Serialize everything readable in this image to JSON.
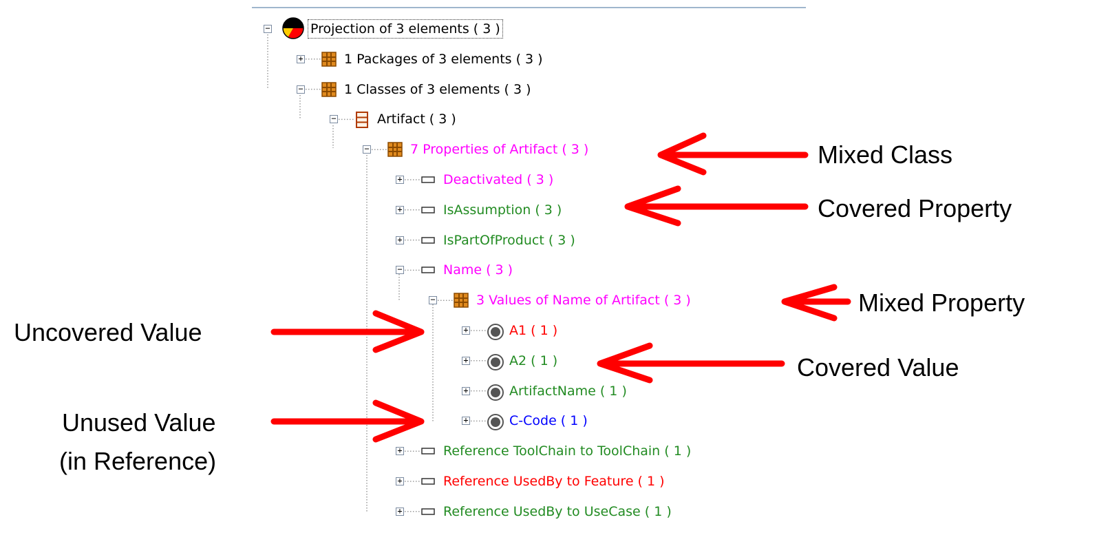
{
  "tree": {
    "rows": [
      {
        "label": "Projection of 3 elements ( 3 )",
        "color": "black",
        "icon": "projection-pie-icon",
        "toggle": "−"
      },
      {
        "label": "1 Packages of 3 elements ( 3 )",
        "color": "black",
        "icon": "grid-group-icon",
        "toggle": "+"
      },
      {
        "label": "1 Classes of 3 elements ( 3 )",
        "color": "black",
        "icon": "grid-group-icon",
        "toggle": "−"
      },
      {
        "label": "Artifact ( 3 )",
        "color": "black",
        "icon": "class-icon",
        "toggle": "−"
      },
      {
        "label": "7 Properties of Artifact ( 3 )",
        "color": "magenta",
        "icon": "grid-group-icon",
        "toggle": "−"
      },
      {
        "label": "Deactivated ( 3 )",
        "color": "magenta",
        "icon": "property-icon",
        "toggle": "+"
      },
      {
        "label": "IsAssumption ( 3 )",
        "color": "green",
        "icon": "property-icon",
        "toggle": "+"
      },
      {
        "label": "IsPartOfProduct ( 3 )",
        "color": "green",
        "icon": "property-icon",
        "toggle": "+"
      },
      {
        "label": "Name ( 3 )",
        "color": "magenta",
        "icon": "property-icon",
        "toggle": "−"
      },
      {
        "label": "3 Values of Name of Artifact ( 3 )",
        "color": "magenta",
        "icon": "grid-group-icon",
        "toggle": "−"
      },
      {
        "label": "A1 ( 1 )",
        "color": "red",
        "icon": "value-circle-icon",
        "toggle": "+"
      },
      {
        "label": "A2 ( 1 )",
        "color": "green",
        "icon": "value-circle-icon",
        "toggle": "+"
      },
      {
        "label": "ArtifactName ( 1 )",
        "color": "green",
        "icon": "value-circle-icon",
        "toggle": "+"
      },
      {
        "label": "C-Code ( 1 )",
        "color": "blue",
        "icon": "value-circle-icon",
        "toggle": "+"
      },
      {
        "label": "Reference ToolChain to ToolChain ( 1 )",
        "color": "green",
        "icon": "property-icon",
        "toggle": "+"
      },
      {
        "label": "Reference UsedBy to Feature ( 1 )",
        "color": "red",
        "icon": "property-icon",
        "toggle": "+"
      },
      {
        "label": "Reference UsedBy to UseCase ( 1 )",
        "color": "green",
        "icon": "property-icon",
        "toggle": "+"
      }
    ]
  },
  "annotations": {
    "mixed_class": "Mixed Class",
    "covered_property": "Covered Property",
    "mixed_property": "Mixed Property",
    "uncovered_value": "Uncovered Value",
    "covered_value": "Covered Value",
    "unused_value_line1": "Unused Value",
    "unused_value_line2": "(in Reference)"
  },
  "colors": {
    "arrow": "#ff0000",
    "magenta": "#ff00ff",
    "green": "#228b22",
    "red": "#ff0000",
    "blue": "#0000ff"
  }
}
